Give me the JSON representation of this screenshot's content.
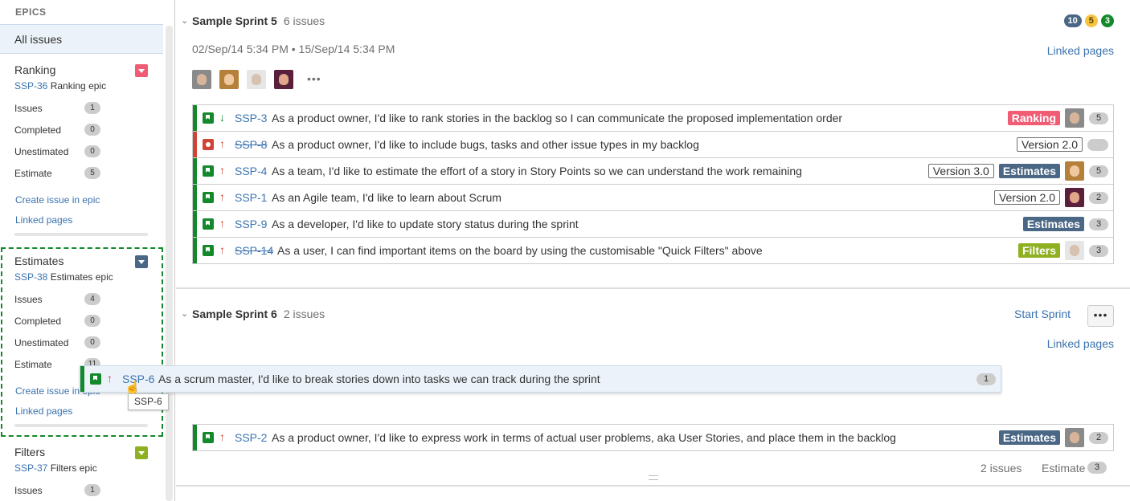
{
  "colors": {
    "story": "#14892c",
    "bug": "#d04437",
    "link": "#3b73af",
    "ranking": "#f15c75",
    "estimates": "#4a6785",
    "filters": "#8eb021",
    "todo_badge": "#4a6785",
    "progress_badge": "#f6c342",
    "done_badge": "#14892c"
  },
  "sidebar": {
    "title": "EPICS",
    "all_issues": "All issues",
    "epics": [
      {
        "name": "Ranking",
        "key": "SSP-36",
        "key_suffix": "Ranking epic",
        "issues_label": "Issues",
        "issues": "1",
        "completed_label": "Completed",
        "completed": "0",
        "unestimated_label": "Unestimated",
        "unestimated": "0",
        "estimate_label": "Estimate",
        "estimate": "5",
        "create_link": "Create issue in epic",
        "linked_link": "Linked pages"
      },
      {
        "name": "Estimates",
        "key": "SSP-38",
        "key_suffix": "Estimates epic",
        "issues_label": "Issues",
        "issues": "4",
        "completed_label": "Completed",
        "completed": "0",
        "unestimated_label": "Unestimated",
        "unestimated": "0",
        "estimate_label": "Estimate",
        "estimate": "11",
        "create_link": "Create issue in epic",
        "linked_link": "Linked pages"
      },
      {
        "name": "Filters",
        "key": "SSP-37",
        "key_suffix": "Filters epic",
        "issues_label": "Issues",
        "issues": "1"
      }
    ]
  },
  "sprint5": {
    "name": "Sample Sprint 5",
    "count": "6 issues",
    "badge_todo": "10",
    "badge_progress": "5",
    "badge_done": "3",
    "dates": "02/Sep/14 5:34 PM • 15/Sep/14 5:34 PM",
    "linked_pages": "Linked pages",
    "more": "•••",
    "issues": [
      {
        "key": "SSP-3",
        "summary": "As a product owner, I'd like to rank stories in the backlog so I can communicate the proposed implementation order",
        "label": "Ranking",
        "estimate": "5",
        "priority": "↓"
      },
      {
        "key": "SSP-8",
        "summary": "As a product owner, I'd like to include bugs, tasks and other issue types in my backlog",
        "version": "Version 2.0",
        "estimate": "",
        "priority": "↑"
      },
      {
        "key": "SSP-4",
        "summary": "As a team, I'd like to estimate the effort of a story in Story Points so we can understand the work remaining",
        "version": "Version 3.0",
        "label": "Estimates",
        "estimate": "5",
        "priority": "↑"
      },
      {
        "key": "SSP-1",
        "summary": "As an Agile team, I'd like to learn about Scrum",
        "version": "Version 2.0",
        "estimate": "2",
        "priority": "↑"
      },
      {
        "key": "SSP-9",
        "summary": "As a developer, I'd like to update story status during the sprint",
        "label": "Estimates",
        "estimate": "3",
        "priority": "↑"
      },
      {
        "key": "SSP-14",
        "summary": "As a user, I can find important items on the board by using the customisable \"Quick Filters\" above",
        "label": "Filters",
        "estimate": "3",
        "priority": "↑"
      }
    ]
  },
  "sprint6": {
    "name": "Sample Sprint 6",
    "count": "2 issues",
    "start_sprint": "Start Sprint",
    "more": "•••",
    "linked_pages": "Linked pages",
    "issues": [
      {
        "key": "SSP-2",
        "summary": "As a product owner, I'd like to express work in terms of actual user problems, aka User Stories, and place them in the backlog",
        "label": "Estimates",
        "estimate": "2",
        "priority": "↑"
      }
    ],
    "footer_count": "2 issues",
    "footer_estimate_label": "Estimate",
    "footer_estimate": "3"
  },
  "dragged": {
    "key": "SSP-6",
    "summary": "As a scrum master, I'd like to break stories down into tasks we can track during the sprint",
    "estimate": "1",
    "priority": "↑",
    "tooltip": "SSP-6"
  }
}
